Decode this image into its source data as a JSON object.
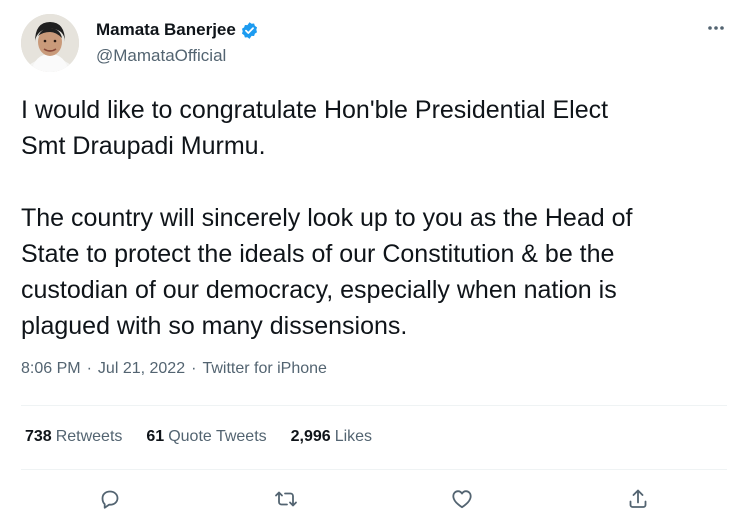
{
  "author": {
    "display_name": "Mamata Banerjee",
    "handle": "@MamataOfficial",
    "verified": true
  },
  "tweet": {
    "text": "I would like to congratulate Hon'ble Presidential Elect\nSmt Draupadi Murmu.\n\nThe country will sincerely look up to you as the Head of\nState to protect the ideals of our Constitution & be the\ncustodian of our democracy, especially when nation is\nplagued with so many dissensions.",
    "time": "8:06 PM",
    "separator": "·",
    "date": "Jul 21, 2022",
    "source": "Twitter for iPhone"
  },
  "stats": {
    "retweets": {
      "count": "738",
      "label": "Retweets"
    },
    "quote_tweets": {
      "count": "61",
      "label": "Quote Tweets"
    },
    "likes": {
      "count": "2,996",
      "label": "Likes"
    }
  },
  "icons": {
    "more": "more-options-icon",
    "verified": "verified-badge-icon",
    "reply": "reply-icon",
    "retweet": "retweet-icon",
    "like": "heart-icon",
    "share": "share-icon"
  },
  "colors": {
    "text_primary": "#0f1419",
    "text_secondary": "#536471",
    "verified_blue": "#1d9bf0",
    "divider": "#eff3f4"
  }
}
